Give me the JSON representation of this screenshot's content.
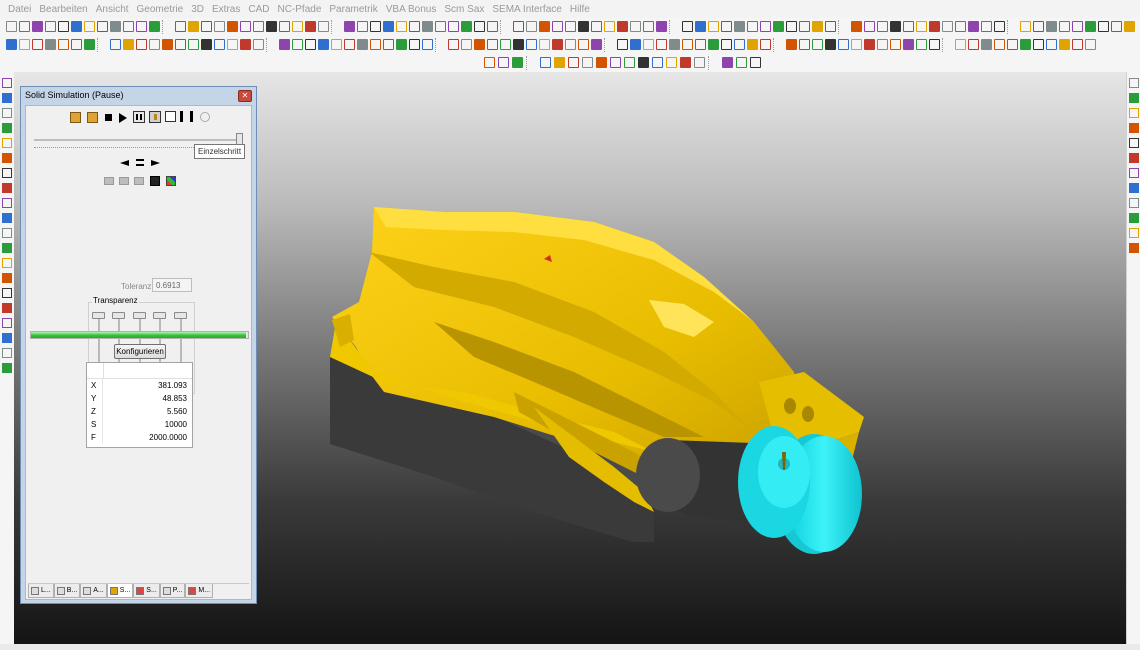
{
  "menu": [
    "Datei",
    "Bearbeiten",
    "Ansicht",
    "Geometrie",
    "3D",
    "Extras",
    "CAD",
    "NC-Pfade",
    "Parametrik",
    "VBA Bonus",
    "Scm Sax",
    "SEMA Interface",
    "Hilfe"
  ],
  "sim_panel": {
    "title": "Solid Simulation (Pause)",
    "tooltip": "Einzelschritt",
    "tolerance_label": "Toleranz",
    "tolerance_value": "0.6913",
    "transparency_label": "Transparenz",
    "progress_fraction": 0.99,
    "configure_label": "Konfigurieren",
    "coords": [
      {
        "key": "X",
        "value": "381.093"
      },
      {
        "key": "Y",
        "value": "48.853"
      },
      {
        "key": "Z",
        "value": "5.560"
      },
      {
        "key": "S",
        "value": "10000"
      },
      {
        "key": "F",
        "value": "2000.0000"
      }
    ],
    "tabs": [
      "L...",
      "B...",
      "A...",
      "S...",
      "S...",
      "P...",
      "M..."
    ],
    "active_tab": 3
  },
  "colors": {
    "workpiece": "#f0c800",
    "tool_holder": "#3c3c3c",
    "tool": "#19e5ef",
    "title_bar": "#c5d5e8"
  }
}
